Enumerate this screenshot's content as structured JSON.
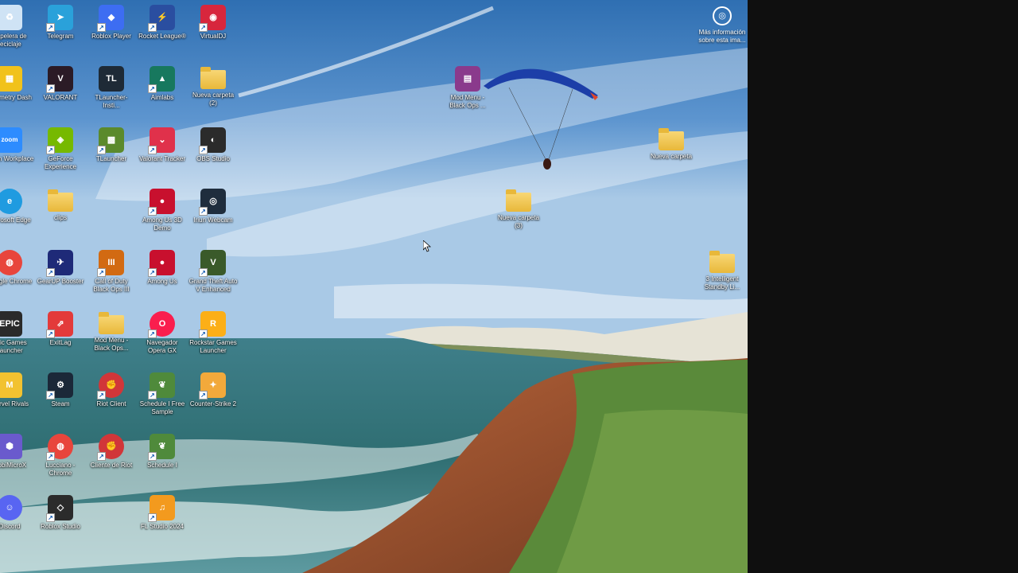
{
  "desktop": {
    "icons": [
      {
        "label": "Papelera de reciclaje",
        "icon": "recycle-bin-icon",
        "color": "#cfe3f5"
      },
      {
        "label": "Telegram",
        "icon": "telegram-icon",
        "color": "#2aa1da"
      },
      {
        "label": "Roblox Player",
        "icon": "roblox-player-icon",
        "color": "#3d6df2"
      },
      {
        "label": "Rocket League®",
        "icon": "rocket-league-icon",
        "color": "#2a4ea0"
      },
      {
        "label": "VirtualDJ",
        "icon": "virtualdj-icon",
        "color": "#d7263d"
      },
      {
        "label": "Geometry Dash",
        "icon": "geometry-dash-icon",
        "color": "#f1c21b"
      },
      {
        "label": "VALORANT",
        "icon": "valorant-icon",
        "color": "#2b1b26"
      },
      {
        "label": "TLauncher-Insti...",
        "icon": "tlauncher-installer-icon",
        "color": "#1e2a36"
      },
      {
        "label": "Aimlabs",
        "icon": "aimlabs-icon",
        "color": "#17785e"
      },
      {
        "label": "Nueva carpeta (2)",
        "icon": "folder-icon",
        "color": "#f5cf61"
      },
      {
        "label": "Zoom Workplace",
        "icon": "zoom-icon",
        "color": "#2d8cff"
      },
      {
        "label": "GeForce Experience",
        "icon": "geforce-experience-icon",
        "color": "#76b900"
      },
      {
        "label": "TLauncher",
        "icon": "tlauncher-icon",
        "color": "#5b8a2c"
      },
      {
        "label": "Valorant Tracker",
        "icon": "valorant-tracker-icon",
        "color": "#e0314b"
      },
      {
        "label": "OBS Studio",
        "icon": "obs-studio-icon",
        "color": "#2b2b2b"
      },
      {
        "label": "Microsoft Edge",
        "icon": "edge-icon",
        "color": "#1f9be0"
      },
      {
        "label": "clips",
        "icon": "folder-icon",
        "color": "#f5cf61"
      },
      {
        "label": "Among Us 3D Demo",
        "icon": "among-us-3d-icon",
        "color": "#c8102e"
      },
      {
        "label": "Iriun Webcam",
        "icon": "iriun-webcam-icon",
        "color": "#1f2d3d"
      },
      {
        "label": "Google Chrome",
        "icon": "chrome-icon",
        "color": "#e8453c"
      },
      {
        "label": "GearUP Booster",
        "icon": "gearup-booster-icon",
        "color": "#1e2a78"
      },
      {
        "label": "Call of Duty Black Ops III",
        "icon": "call-of-duty-icon",
        "color": "#d26a12"
      },
      {
        "label": "Among Us",
        "icon": "among-us-icon",
        "color": "#c8102e"
      },
      {
        "label": "Grand Theft Auto V Enhanced",
        "icon": "gta-v-icon",
        "color": "#3a5a2a"
      },
      {
        "label": "Epic Games Launcher",
        "icon": "epic-games-icon",
        "color": "#2a2a2a"
      },
      {
        "label": "ExitLag",
        "icon": "exitlag-icon",
        "color": "#e33a3a"
      },
      {
        "label": "Mod Menu - Black Ops...",
        "icon": "folder-icon",
        "color": "#f5cf61"
      },
      {
        "label": "Navegador Opera GX",
        "icon": "opera-gx-icon",
        "color": "#fa1e4e"
      },
      {
        "label": "Rockstar Games Launcher",
        "icon": "rockstar-games-icon",
        "color": "#fcaf17"
      },
      {
        "label": "Marvel Rivals",
        "icon": "marvel-rivals-icon",
        "color": "#f2c230"
      },
      {
        "label": "Steam",
        "icon": "steam-icon",
        "color": "#1b2838"
      },
      {
        "label": "Riot Client",
        "icon": "riot-client-icon",
        "color": "#d13639"
      },
      {
        "label": "Schedule I Free Sample",
        "icon": "schedule-i-free-sample-icon",
        "color": "#4f8a3b"
      },
      {
        "label": "Counter-Strike 2",
        "icon": "counter-strike-2-icon",
        "color": "#f2a93b"
      },
      {
        "label": "MobiMicroX",
        "icon": "mobimicrox-icon",
        "color": "#6a5acd"
      },
      {
        "label": "Lucciano - Chrome",
        "icon": "chrome-profile-icon",
        "color": "#e8453c"
      },
      {
        "label": "Cliente de Riot",
        "icon": "riot-client-icon",
        "color": "#d13639"
      },
      {
        "label": "Schedule I",
        "icon": "schedule-i-icon",
        "color": "#4f8a3b"
      },
      {
        "label": "Discord",
        "icon": "discord-icon",
        "color": "#5865f2"
      },
      {
        "label": "Roblox Studio",
        "icon": "roblox-studio-icon",
        "color": "#2b2b2b"
      },
      {
        "label": "FL Studio 2024",
        "icon": "fl-studio-icon",
        "color": "#f39a1e"
      },
      {
        "label": "Mod Menu - Black Ops ...",
        "icon": "winrar-archive-icon",
        "color": "#8a3a8c"
      },
      {
        "label": "Nueva carpeta (3)",
        "icon": "folder-icon",
        "color": "#f5cf61"
      },
      {
        "label": "Nueva carpeta",
        "icon": "folder-icon",
        "color": "#f5cf61"
      },
      {
        "label": "3 Intelligent Standby Li...",
        "icon": "folder-icon",
        "color": "#f5cf61"
      }
    ],
    "info_button": {
      "label": "Más información sobre esta ima...",
      "icon": "camera-info-icon"
    }
  }
}
